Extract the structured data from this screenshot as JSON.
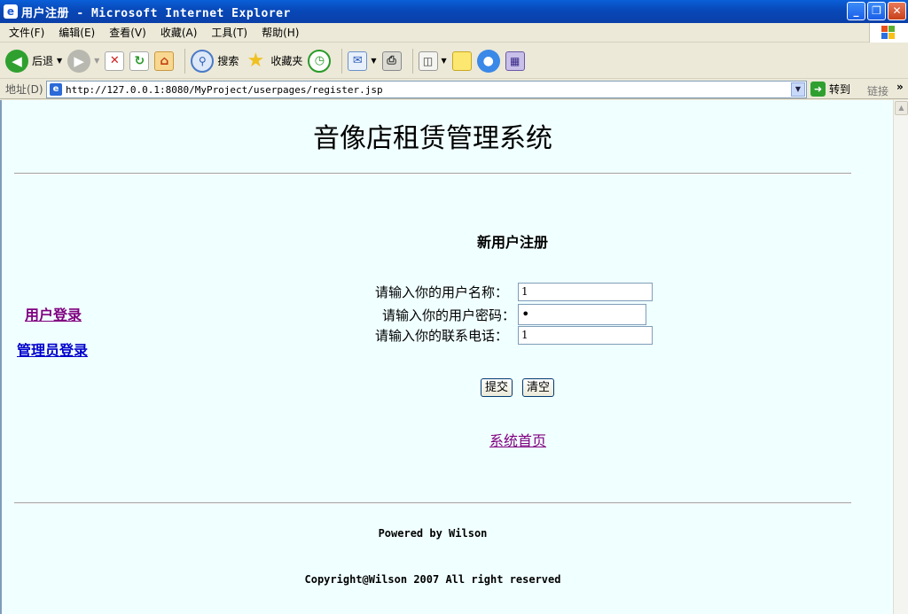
{
  "window": {
    "title": "用户注册 - Microsoft Internet Explorer",
    "controls": [
      "_",
      "❐",
      "✕"
    ]
  },
  "menu": [
    "文件(F)",
    "编辑(E)",
    "查看(V)",
    "收藏(A)",
    "工具(T)",
    "帮助(H)"
  ],
  "toolbar": {
    "back_label": "后退",
    "search_label": "搜索",
    "favorites_label": "收藏夹"
  },
  "address": {
    "label": "地址(D)",
    "url": "http://127.0.0.1:8080/MyProject/userpages/register.jsp",
    "go_label": "转到",
    "links_label": "链接"
  },
  "page": {
    "title": "音像店租赁管理系统",
    "nav": {
      "user_login": "用户登录",
      "admin_login": "管理员登录"
    },
    "form": {
      "heading": "新用户注册",
      "username_label": "请输入你的用户名称：",
      "username_value": "1",
      "password_label": "请输入你的用户密码：",
      "password_value": "•",
      "phone_label": "请输入你的联系电话：",
      "phone_value": "1",
      "submit_label": "提交",
      "clear_label": "清空"
    },
    "home_link": "系统首页",
    "footer": {
      "powered": "Powered by Wilson",
      "copyright": "Copyright@Wilson 2007 All right reserved"
    },
    "colors": {
      "background": "#f0ffff",
      "visited_link": "#800080",
      "link": "#0000cc"
    }
  }
}
